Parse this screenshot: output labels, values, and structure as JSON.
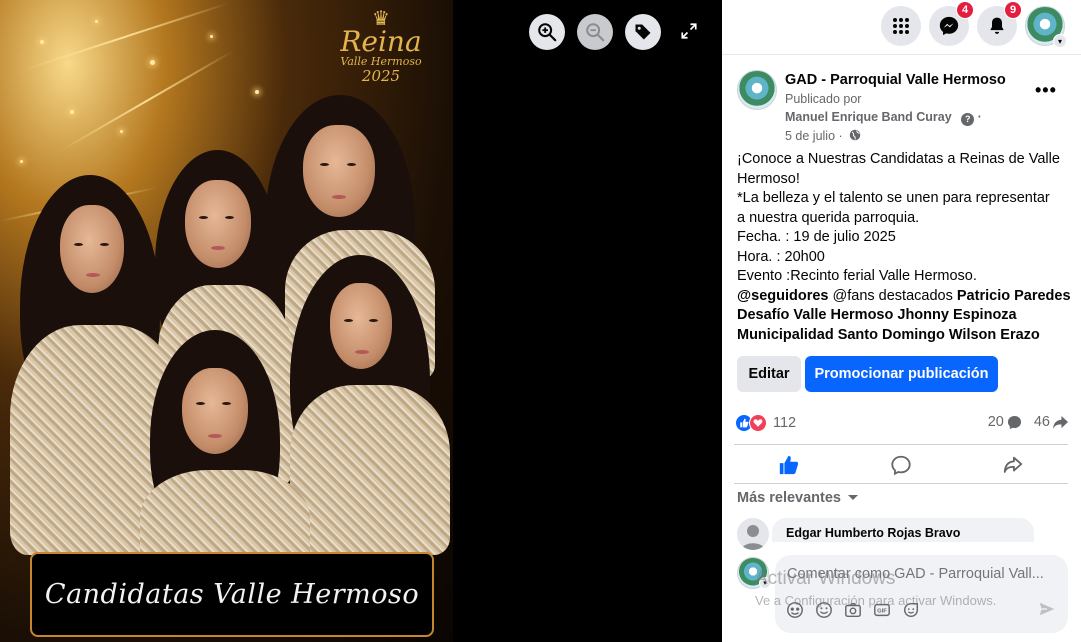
{
  "viewer": {
    "brand": {
      "title": "Reina",
      "subtitle": "Valle Hermoso",
      "year": "2025"
    },
    "caption": "Candidatas Valle Hermoso",
    "tools": [
      {
        "name": "zoom-in-icon"
      },
      {
        "name": "zoom-out-icon"
      },
      {
        "name": "tag-icon"
      },
      {
        "name": "fullscreen-icon"
      }
    ]
  },
  "nav": {
    "messenger_badge": "4",
    "notifications_badge": "9"
  },
  "post": {
    "page_name": "GAD - Parroquial Valle Hermoso",
    "published_by": "Publicado por",
    "author": "Manuel Enrique Band Curay",
    "author_suffix": "·",
    "date": "5 de julio ·",
    "text": {
      "line1": "¡Conoce a Nuestras Candidatas a Reinas de Valle",
      "line2": "Hermoso!",
      "line3": "*La belleza y el talento se unen para representar",
      "line4": "a nuestra querida parroquia.",
      "line5": "Fecha. : 19 de julio 2025",
      "line6": "Hora. : 20h00",
      "line7": "Evento :Recinto ferial Valle Hermoso.",
      "tag_seguidores": "@seguidores",
      "tag_fans": " @fans destacados ",
      "tag_patricio": "Patricio Paredes",
      "tag_desafio": "Desafío Valle Hermoso",
      "tag_jhonny": "Jhonny Espinoza",
      "tag_municipalidad": "Municipalidad Santo Domingo",
      "tag_wilson": "Wilson Erazo"
    },
    "edit_label": "Editar",
    "promote_label": "Promocionar publicación",
    "reactions_count": "112",
    "comments_count": "20",
    "shares_count": "46",
    "sort_label": "Más relevantes",
    "comment_author": "Edgar Humberto Rojas Bravo",
    "composer_placeholder": "Comentar como GAD - Parroquial Vall..."
  },
  "watermark": {
    "title": "Activar Windows",
    "subtitle": "Ve a Configuración para activar Windows."
  },
  "colors": {
    "brand_blue": "#0866ff",
    "badge_red": "#e41e3f",
    "caption_border": "#c5862d"
  }
}
